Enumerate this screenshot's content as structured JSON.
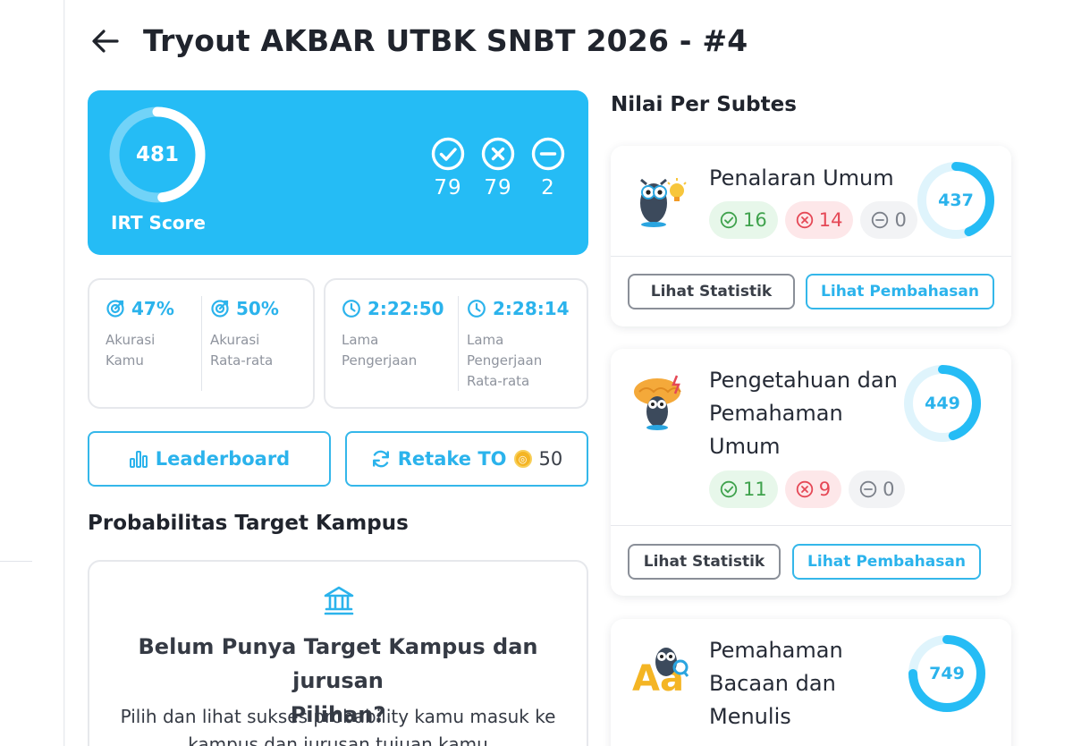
{
  "header": {
    "title": "Tryout AKBAR UTBK SNBT 2026 - #4",
    "back_icon": "arrow-left-icon"
  },
  "score_card": {
    "score": "481",
    "score_progress": 0.48,
    "label": "IRT Score",
    "correct": "79",
    "wrong": "79",
    "skipped": "2",
    "bg_color": "#25bcf5"
  },
  "accuracy": {
    "mine_value": "47%",
    "mine_label_1": "Akurasi",
    "mine_label_2": "Kamu",
    "avg_value": "50%",
    "avg_label_1": "Akurasi",
    "avg_label_2": "Rata-rata"
  },
  "duration": {
    "mine_value": "2:22:50",
    "mine_label_1": "Lama",
    "mine_label_2": "Pengerjaan",
    "avg_value": "2:28:14",
    "avg_label_1": "Lama",
    "avg_label_2": "Pengerjaan",
    "avg_label_3": "Rata-rata"
  },
  "actions": {
    "leaderboard": "Leaderboard",
    "retake": "Retake TO",
    "retake_cost": "50"
  },
  "probability": {
    "title": "Probabilitas Target Kampus",
    "heading_1": "Belum Punya Target Kampus dan jurusan",
    "heading_2": "Pilihan?",
    "desc_1": "Pilih dan lihat sukses probability kamu masuk ke",
    "desc_2": "kampus dan jurusan tujuan kamu"
  },
  "subtests": {
    "title": "Nilai Per Subtes",
    "items": [
      {
        "name_1": "Penalaran Umum",
        "score": "437",
        "progress": 0.437,
        "correct": "16",
        "wrong": "14",
        "skipped": "0",
        "stat_label": "Lihat Statistik",
        "disc_label": "Lihat Pembahasan"
      },
      {
        "name_1": "Pengetahuan dan",
        "name_2": "Pemahaman",
        "name_3": "Umum",
        "score": "449",
        "progress": 0.449,
        "correct": "11",
        "wrong": "9",
        "skipped": "0",
        "stat_label": "Lihat Statistik",
        "disc_label": "Lihat Pembahasan"
      },
      {
        "name_1": "Pemahaman",
        "name_2": "Bacaan dan",
        "name_3": "Menulis",
        "score": "749",
        "progress": 0.749
      }
    ]
  }
}
